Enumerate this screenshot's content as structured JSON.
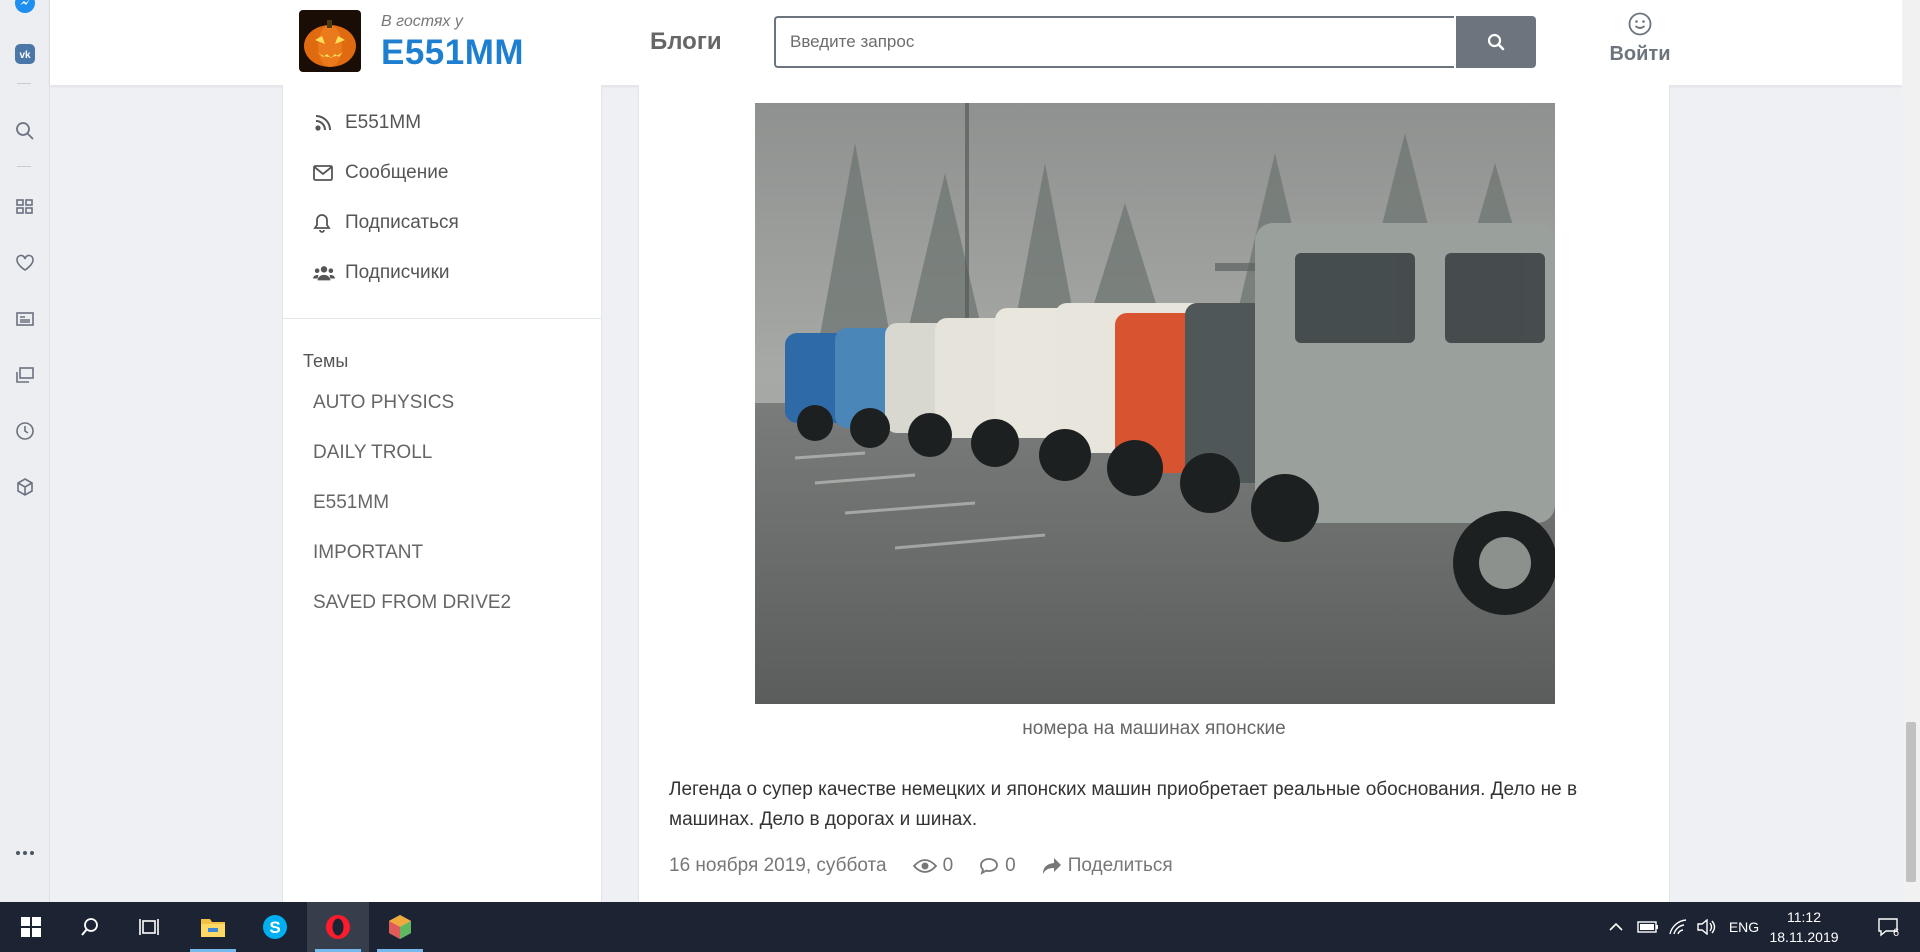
{
  "header": {
    "guest_label": "В гостях у",
    "site_name": "E551MM",
    "blogs_label": "Блоги",
    "search_placeholder": "Введите запрос",
    "login_label": "Войти"
  },
  "sidebar": {
    "menu": [
      {
        "label": "E551MM",
        "icon": "blog-icon"
      },
      {
        "label": "Сообщение",
        "icon": "envelope-icon"
      },
      {
        "label": "Подписаться",
        "icon": "bell-icon"
      },
      {
        "label": "Подписчики",
        "icon": "users-icon"
      }
    ],
    "topics_title": "Темы",
    "topics": [
      "AUTO PHYSICS",
      "DAILY TROLL",
      "E551MM",
      "IMPORTANT",
      "SAVED FROM DRIVE2"
    ]
  },
  "article": {
    "photo": "Row of vintage cars and vans parked in fog",
    "caption": "номера на машинах японские",
    "text": "Легенда о супер качестве немецких и японских машин приобретает реальные обоснования. Дело не в машинах. Дело в дорогах и шинах.",
    "date": "16 ноября 2019, суббота",
    "views": "0",
    "comments": "0",
    "share_label": "Поделиться"
  },
  "taskbar": {
    "language": "ENG",
    "time": "11:12",
    "date": "18.11.2019",
    "notifications": "6"
  },
  "colors": {
    "accent": "#1e7fd0",
    "search_button": "#6c757d",
    "taskbar": "#1c2433"
  }
}
